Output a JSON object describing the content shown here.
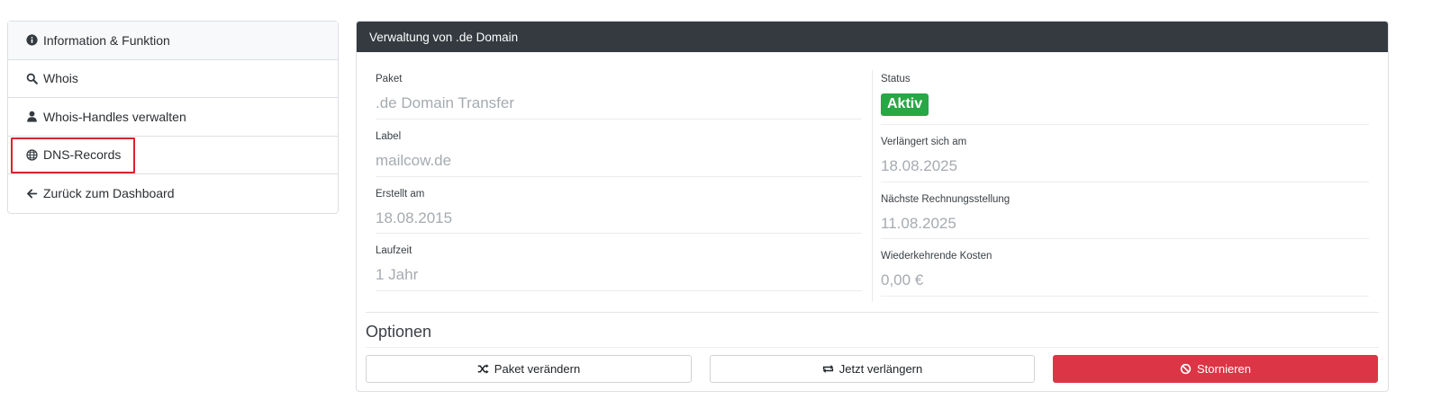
{
  "sidebar": {
    "items": [
      {
        "label": "Information & Funktion",
        "icon": "info-circle-icon"
      },
      {
        "label": "Whois",
        "icon": "search-icon"
      },
      {
        "label": "Whois-Handles verwalten",
        "icon": "user-icon"
      },
      {
        "label": "DNS-Records",
        "icon": "globe-icon"
      },
      {
        "label": "Zurück zum Dashboard",
        "icon": "arrow-left-icon"
      }
    ]
  },
  "panel": {
    "title": "Verwaltung von .de Domain",
    "left": {
      "paket_label": "Paket",
      "paket_value": ".de Domain Transfer",
      "label_label": "Label",
      "label_value": "mailcow.de",
      "erstellt_label": "Erstellt am",
      "erstellt_value": "18.08.2015",
      "laufzeit_label": "Laufzeit",
      "laufzeit_value": "1 Jahr"
    },
    "right": {
      "status_label": "Status",
      "status_value": "Aktiv",
      "verlaengert_label": "Verlängert sich am",
      "verlaengert_value": "18.08.2025",
      "rechnung_label": "Nächste Rechnungsstellung",
      "rechnung_value": "11.08.2025",
      "kosten_label": "Wiederkehrende Kosten",
      "kosten_value": "0,00 €"
    },
    "options": {
      "title": "Optionen",
      "change_package": "Paket verändern",
      "renew_now": "Jetzt verlängern",
      "cancel": "Stornieren"
    }
  },
  "colors": {
    "header_bg": "#343a40",
    "status_green": "#28a745",
    "danger_red": "#dc3545",
    "highlight_red": "#d9232d"
  }
}
